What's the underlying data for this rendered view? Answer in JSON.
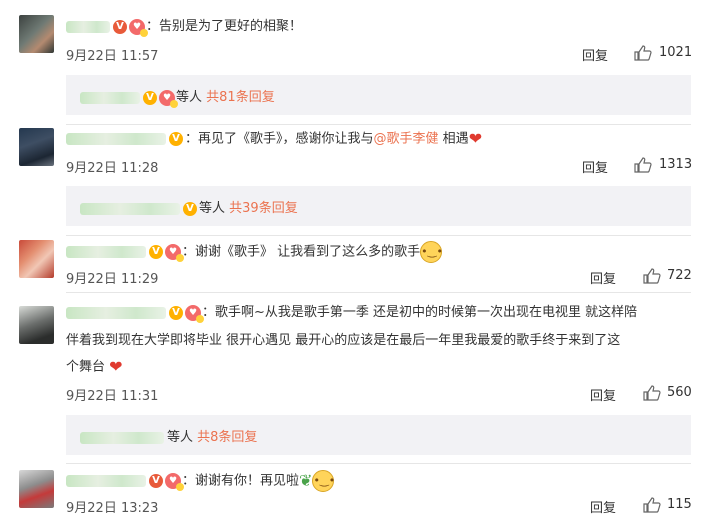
{
  "comments": [
    {
      "text": "告别是为了更好的相聚！",
      "time": "9月22日 11:57",
      "reply_label": "回复",
      "likes": "1021",
      "sub": {
        "people": "等人",
        "total": "共81条回复"
      }
    },
    {
      "text_before": "再见了《歌手》，感谢你让我与",
      "mention": "@歌手李健",
      "text_after": " 相遇",
      "time": "9月22日 11:28",
      "reply_label": "回复",
      "likes": "1313",
      "sub": {
        "people": "等人",
        "total": "共39条回复"
      }
    },
    {
      "text": "谢谢《歌手》 让我看到了这么多的歌手",
      "time": "9月22日 11:29",
      "reply_label": "回复",
      "likes": "722"
    },
    {
      "text_line1": "歌手啊~从我是歌手第一季 还是初中的时候第一次出现在电视里 就这样陪",
      "text_line2": "伴着我到现在大学即将毕业 很开心遇见 最开心的应该是在最后一年里我最爱的歌手终于来到了这",
      "text_line3": "个舞台",
      "time": "9月22日 11:31",
      "reply_label": "回复",
      "likes": "560",
      "sub": {
        "people": "等人",
        "total": "共8条回复"
      }
    },
    {
      "text": "谢谢有你！再见啦",
      "time": "9月22日 13:23",
      "reply_label": "回复",
      "likes": "115"
    }
  ],
  "colors": {
    "accent": "#eb7350",
    "vip": "#ffb100",
    "heart": "#e03a2f"
  },
  "icons": [
    "thumbs-up-icon",
    "vip-badge-icon",
    "medal-icon",
    "heart-icon",
    "emoji-icon",
    "leaf-icon"
  ]
}
